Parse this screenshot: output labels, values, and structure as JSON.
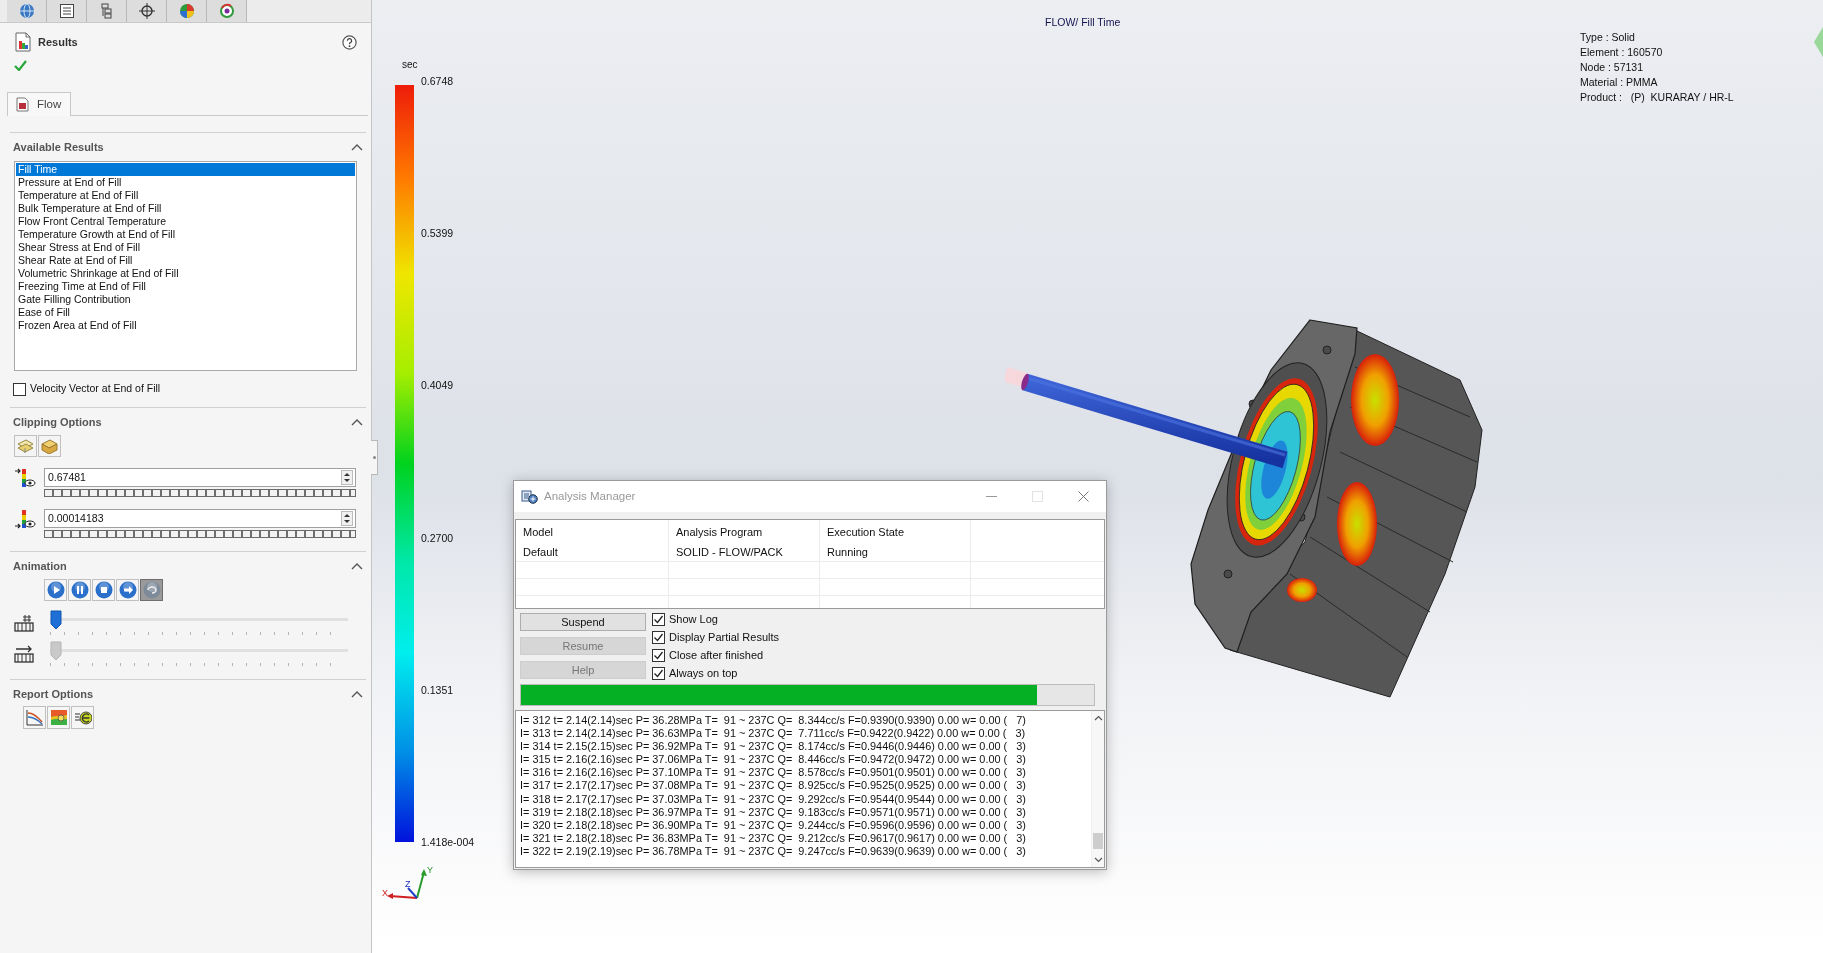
{
  "results_panel": {
    "title": "Results",
    "tab": "Flow",
    "available_results": {
      "title": "Available Results",
      "items": [
        {
          "label": "Fill Time",
          "selected": true
        },
        {
          "label": "Pressure at End of Fill",
          "selected": false
        },
        {
          "label": "Temperature at End of Fill",
          "selected": false
        },
        {
          "label": "Bulk Temperature at End of Fill",
          "selected": false
        },
        {
          "label": "Flow Front Central Temperature",
          "selected": false
        },
        {
          "label": "Temperature Growth at End of Fill",
          "selected": false
        },
        {
          "label": "Shear Stress at End of Fill",
          "selected": false
        },
        {
          "label": "Shear Rate at End of Fill",
          "selected": false
        },
        {
          "label": "Volumetric Shrinkage at End of Fill",
          "selected": false
        },
        {
          "label": "Freezing Time at End of Fill",
          "selected": false
        },
        {
          "label": "Gate Filling Contribution",
          "selected": false
        },
        {
          "label": "Ease of Fill",
          "selected": false
        },
        {
          "label": "Frozen Area at End of Fill",
          "selected": false
        }
      ]
    },
    "velocity_vector": {
      "label": "Velocity Vector at End of Fill",
      "checked": false
    },
    "clipping_options": {
      "title": "Clipping Options",
      "upper_value": "0.67481",
      "lower_value": "0.00014183"
    },
    "animation": {
      "title": "Animation",
      "controls": [
        {
          "kind": "play",
          "pressed": false
        },
        {
          "kind": "pause",
          "pressed": false
        },
        {
          "kind": "stop",
          "pressed": false
        },
        {
          "kind": "next",
          "pressed": false
        },
        {
          "kind": "loop",
          "pressed": true
        }
      ],
      "sliders": [
        {
          "kind": "frame",
          "level": 0,
          "disabled": false
        },
        {
          "kind": "speed",
          "level": 0,
          "disabled": true
        }
      ]
    },
    "report_options": {
      "title": "Report Options"
    }
  },
  "color_scale": {
    "unit": "sec",
    "labels": [
      "0.6748",
      "0.5399",
      "0.4049",
      "0.2700",
      "0.1351",
      "1.418e-004"
    ]
  },
  "viewport": {
    "result_title": "FLOW/ Fill Time",
    "model_info": [
      "Type : Solid",
      "Element : 160570",
      "Node : 57131",
      "Material : PMMA",
      "Product :   (P)  KURARAY / HR-L"
    ],
    "axes": [
      "X",
      "Y",
      "Z"
    ]
  },
  "analysis_manager": {
    "title": "Analysis Manager",
    "columns": [
      "Model",
      "Analysis Program",
      "Execution State"
    ],
    "rows": [
      [
        "Default",
        "SOLID - FLOW/PACK",
        "Running"
      ]
    ],
    "buttons": [
      {
        "label": "Suspend",
        "disabled": false
      },
      {
        "label": "Resume",
        "disabled": true
      },
      {
        "label": "Help",
        "disabled": true
      }
    ],
    "options": [
      {
        "label": "Show Log",
        "checked": true
      },
      {
        "label": "Display Partial Results",
        "checked": true
      },
      {
        "label": "Close after finished",
        "checked": true
      },
      {
        "label": "Always on top",
        "checked": true
      }
    ],
    "progress": {
      "level": 0.9
    },
    "log": [
      "I= 312 t= 2.14(2.14)sec P= 36.28MPa T=  91 ~ 237C Q=  8.344cc/s F=0.9390(0.9390) 0.00 w= 0.00 (   7)",
      "I= 313 t= 2.14(2.14)sec P= 36.63MPa T=  91 ~ 237C Q=  7.711cc/s F=0.9422(0.9422) 0.00 w= 0.00 (   3)",
      "I= 314 t= 2.15(2.15)sec P= 36.92MPa T=  91 ~ 237C Q=  8.174cc/s F=0.9446(0.9446) 0.00 w= 0.00 (   3)",
      "I= 315 t= 2.16(2.16)sec P= 37.06MPa T=  91 ~ 237C Q=  8.446cc/s F=0.9472(0.9472) 0.00 w= 0.00 (   3)",
      "I= 316 t= 2.16(2.16)sec P= 37.10MPa T=  91 ~ 237C Q=  8.578cc/s F=0.9501(0.9501) 0.00 w= 0.00 (   3)",
      "I= 317 t= 2.17(2.17)sec P= 37.08MPa T=  91 ~ 237C Q=  8.925cc/s F=0.9525(0.9525) 0.00 w= 0.00 (   3)",
      "I= 318 t= 2.17(2.17)sec P= 37.03MPa T=  91 ~ 237C Q=  9.292cc/s F=0.9544(0.9544) 0.00 w= 0.00 (   3)",
      "I= 319 t= 2.18(2.18)sec P= 36.97MPa T=  91 ~ 237C Q=  9.183cc/s F=0.9571(0.9571) 0.00 w= 0.00 (   3)",
      "I= 320 t= 2.18(2.18)sec P= 36.90MPa T=  91 ~ 237C Q=  9.244cc/s F=0.9596(0.9596) 0.00 w= 0.00 (   3)",
      "I= 321 t= 2.18(2.18)sec P= 36.83MPa T=  91 ~ 237C Q=  9.212cc/s F=0.9617(0.9617) 0.00 w= 0.00 (   3)",
      "I= 322 t= 2.19(2.19)sec P= 36.78MPa T=  91 ~ 237C Q=  9.247cc/s F=0.9639(0.9639) 0.00 w= 0.00 (   3)"
    ]
  }
}
